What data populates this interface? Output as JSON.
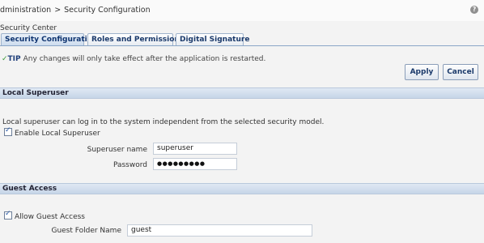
{
  "breadcrumb": {
    "parent": "dministration",
    "separator": ">",
    "current": "Security Configuration"
  },
  "help_icon": "?",
  "section_label": "Security Center",
  "tabs": [
    {
      "label": "Security Configuration",
      "active": true
    },
    {
      "label": "Roles and Permissions",
      "active": false
    },
    {
      "label": "Digital Signature",
      "active": false
    }
  ],
  "tip": {
    "check": "✓",
    "label": "TIP",
    "text": "Any changes will only take effect after the application is restarted."
  },
  "buttons": {
    "apply": "Apply",
    "cancel": "Cancel"
  },
  "local_superuser": {
    "header": "Local Superuser",
    "description": "Local superuser can log in to the system independent from the selected security model.",
    "enable_label": "Enable Local Superuser",
    "enable_checked": true,
    "name_label": "Superuser name",
    "name_value": "superuser",
    "password_label": "Password",
    "password_value": "●●●●●●●●●"
  },
  "guest_access": {
    "header": "Guest Access",
    "allow_label": "Allow Guest Access",
    "allow_checked": true,
    "folder_label": "Guest Folder Name",
    "folder_value": "guest"
  },
  "colors": {
    "tab_text": "#1b3a6b",
    "panel_header": "#c6d5e8",
    "check": "#3a9a3a"
  }
}
